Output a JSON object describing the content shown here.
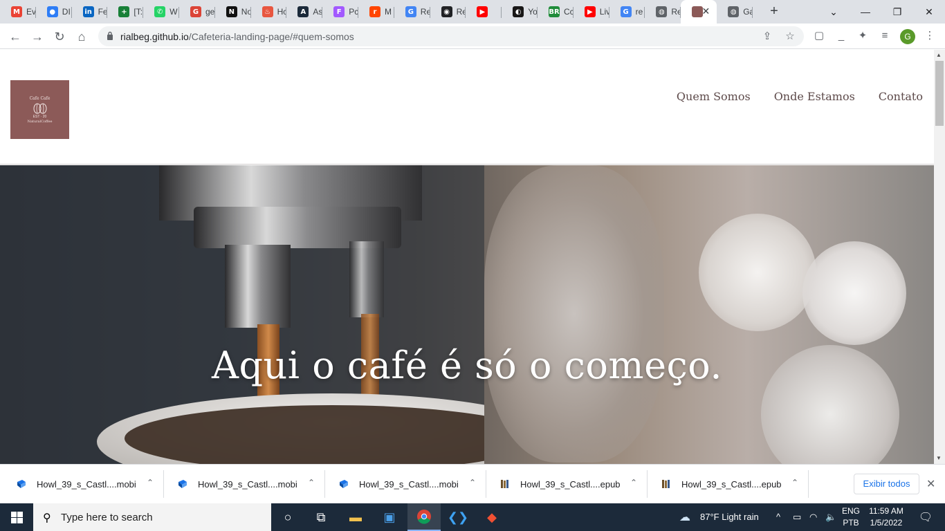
{
  "browser": {
    "tabs": [
      {
        "icon": "gmail-icon",
        "label": "Ev",
        "color": "#ea4335",
        "glyph": "M"
      },
      {
        "icon": "drive-icon",
        "label": "DI",
        "color": "#2e7df6",
        "glyph": "●"
      },
      {
        "icon": "linkedin-icon",
        "label": "Fe",
        "color": "#0a66c2",
        "glyph": "in"
      },
      {
        "icon": "sheets-icon",
        "label": "[T:",
        "color": "#188038",
        "glyph": "+"
      },
      {
        "icon": "whatsapp-icon",
        "label": "W",
        "color": "#25d366",
        "glyph": "✆"
      },
      {
        "icon": "google-icon",
        "label": "ge",
        "color": "#db4437",
        "glyph": "G"
      },
      {
        "icon": "notion-icon",
        "label": "No",
        "color": "#111111",
        "glyph": "N"
      },
      {
        "icon": "fire-icon",
        "label": "Hc",
        "color": "#e8563f",
        "glyph": "♨"
      },
      {
        "icon": "app-icon",
        "label": "As",
        "color": "#1b2a3a",
        "glyph": "A"
      },
      {
        "icon": "figma-icon",
        "label": "Pc",
        "color": "#a259ff",
        "glyph": "F"
      },
      {
        "icon": "reddit-icon",
        "label": "M",
        "color": "#ff4500",
        "glyph": "r"
      },
      {
        "icon": "google-icon",
        "label": "Re",
        "color": "#4285f4",
        "glyph": "G"
      },
      {
        "icon": "record-icon",
        "label": "Re",
        "color": "#202124",
        "glyph": "◉"
      },
      {
        "icon": "youtube-icon",
        "label": "",
        "color": "#ff0000",
        "glyph": "▶"
      },
      {
        "icon": "github-icon",
        "label": "Yo",
        "color": "#181717",
        "glyph": "◐"
      },
      {
        "icon": "br-icon",
        "label": "Cc",
        "color": "#1f8c3a",
        "glyph": "BR"
      },
      {
        "icon": "youtube-icon",
        "label": "Liv",
        "color": "#ff0000",
        "glyph": "▶"
      },
      {
        "icon": "google-icon",
        "label": "re",
        "color": "#4285f4",
        "glyph": "G"
      },
      {
        "icon": "globe-icon",
        "label": "Re",
        "color": "#5f6368",
        "glyph": "◍"
      },
      {
        "icon": "cafe-favicon",
        "label": "",
        "color": "#8c5a58",
        "glyph": "",
        "active": true
      },
      {
        "icon": "globe-icon",
        "label": "Ga",
        "color": "#5f6368",
        "glyph": "◍"
      }
    ],
    "url_host": "rialbeg.github.io",
    "url_path": "/Cafeteria-landing-page/#quem-somos",
    "profile_initial": "G"
  },
  "site": {
    "logo": {
      "line1": "Cafe Cafe",
      "line2": "EST · 20",
      "line3": "NaturalCoffee"
    },
    "nav": [
      "Quem Somos",
      "Onde Estamos",
      "Contato"
    ],
    "hero_title": "Aqui o café é só o começo."
  },
  "downloads": {
    "items": [
      {
        "name": "Howl_39_s_Castl....mobi",
        "icon": "mobi-file-icon"
      },
      {
        "name": "Howl_39_s_Castl....mobi",
        "icon": "mobi-file-icon"
      },
      {
        "name": "Howl_39_s_Castl....mobi",
        "icon": "mobi-file-icon"
      },
      {
        "name": "Howl_39_s_Castl....epub",
        "icon": "epub-file-icon"
      },
      {
        "name": "Howl_39_s_Castl....epub",
        "icon": "epub-file-icon"
      }
    ],
    "show_all": "Exibir todos"
  },
  "taskbar": {
    "search_placeholder": "Type here to search",
    "weather": "87°F  Light rain",
    "lang1": "ENG",
    "lang2": "PTB",
    "time": "11:59 AM",
    "date": "1/5/2022"
  }
}
